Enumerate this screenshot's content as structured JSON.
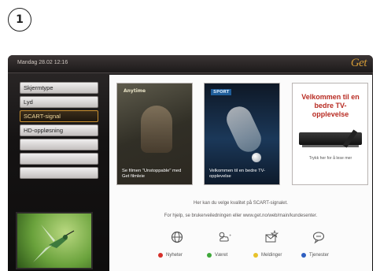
{
  "step": {
    "number": "1"
  },
  "header": {
    "datetime": "Mandag 28.02 12:16",
    "brand": "Get"
  },
  "menu": {
    "items": [
      {
        "label": "Skjermtype"
      },
      {
        "label": "Lyd"
      },
      {
        "label": "SCART-signal",
        "selected": true
      },
      {
        "label": "HD-oppløsning"
      },
      {
        "label": ""
      },
      {
        "label": ""
      },
      {
        "label": ""
      }
    ]
  },
  "posters": [
    {
      "tag": "Anytime",
      "caption": "Se filmen \"Unstoppable\" med Get filmleie"
    },
    {
      "tag": "SPORT",
      "caption": "Velkommen til en bedre TV-opplevelse"
    },
    {
      "title": "Velkommen til en bedre TV-opplevelse",
      "cta": "Trykk her for å lese mer"
    }
  ],
  "info": {
    "line1": "Her kan du velge kvalitet på SCART-signalet.",
    "line2": "For hjelp, se brukerveiledningen eller  www.get.no/web/main/kundesenter."
  },
  "shortcut_icons": [
    "globe-icon",
    "weather-icon",
    "message-icon",
    "chat-icon"
  ],
  "legend": [
    {
      "label": "Nyheter",
      "color": "#d6302a"
    },
    {
      "label": "Været",
      "color": "#3fa83a"
    },
    {
      "label": "Meldinger",
      "color": "#e7c22a"
    },
    {
      "label": "Tjenester",
      "color": "#2f5fc1"
    }
  ],
  "colors": {
    "accent": "#c9902f",
    "brand": "#d29a36"
  }
}
